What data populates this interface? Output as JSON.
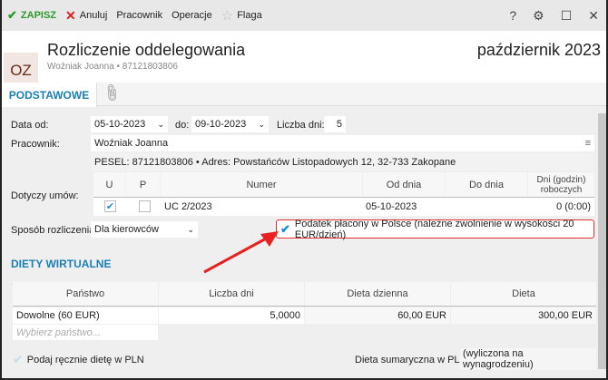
{
  "toolbar": {
    "save": "ZAPISZ",
    "cancel": "Anuluj",
    "employee": "Pracownik",
    "operations": "Operacje",
    "flag": "Flaga",
    "help": "?"
  },
  "header": {
    "badge": "OZ",
    "title": "Rozliczenie oddelegowania",
    "subtitle": "Woźniak Joanna  •  87121803806",
    "period": "październik 2023"
  },
  "tabs": {
    "main": "PODSTAWOWE"
  },
  "form": {
    "date_from_label": "Data od:",
    "date_from": "05-10-2023",
    "date_to_label": "do:",
    "date_to": "09-10-2023",
    "days_label": "Liczba dni:",
    "days": "5",
    "employee_label": "Pracownik:",
    "employee": "Woźniak Joanna",
    "info": "PESEL:  87121803806  •  Adres:  Powstańców Listopadowych 12, 32-733 Zakopane",
    "contracts_label": "Dotyczy umów:",
    "contracts_headers": [
      "U",
      "P",
      "Numer",
      "Od dnia",
      "Do dnia",
      "Dni (godzin) roboczych"
    ],
    "contracts_rows": [
      {
        "u": true,
        "p": false,
        "number": "UC 2/2023",
        "from": "05-10-2023",
        "to": "",
        "days": "0  (0:00)"
      }
    ],
    "settlement_label": "Sposób rozliczenia:",
    "settlement": "Dla kierowców",
    "tax_checkbox": "Podatek płacony w Polsce (należne zwolnienie w wysokości 20 EUR/dzień)",
    "tax_checked": true
  },
  "diets": {
    "title": "DIETY WIRTUALNE",
    "headers": [
      "Państwo",
      "Liczba dni",
      "Dieta dzienna",
      "Dieta"
    ],
    "rows": [
      [
        "Dowolne (60 EUR)",
        "5,0000",
        "60,00 EUR",
        "300,00 EUR"
      ]
    ],
    "placeholder": "Wybierz państwo...",
    "manual_label": "Podaj ręcznie dietę w PLN",
    "total_label": "Dieta sumaryczna w PLN:",
    "total_value": "(wyliczona na wynagrodzeniu)"
  },
  "colors": {
    "accent": "#1a7fb5",
    "save": "#2e9a2e",
    "cancel": "#e02020",
    "highlight": "#e03030"
  }
}
